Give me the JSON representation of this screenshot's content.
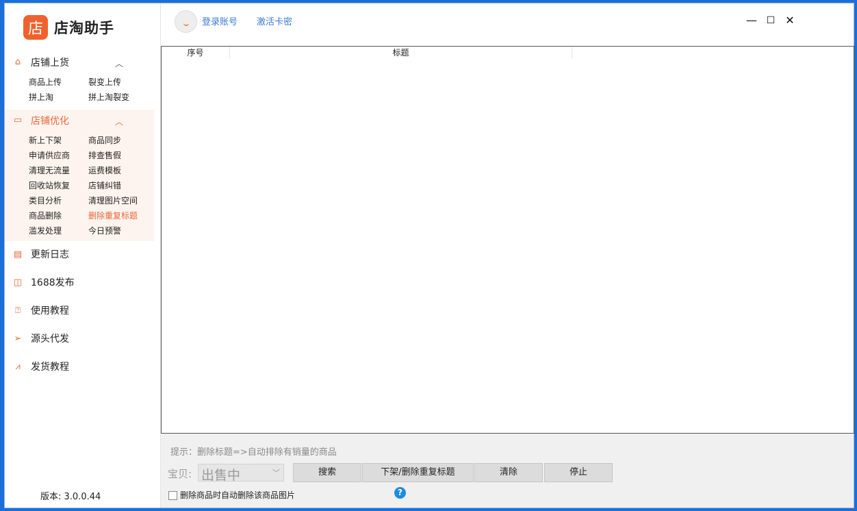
{
  "app": {
    "name": "店淘助手",
    "logo_char": "店",
    "version_label": "版本: 3.0.0.44"
  },
  "header": {
    "login": "登录账号",
    "activate": "激活卡密"
  },
  "window_controls": {
    "minimize": "—",
    "maximize": "☐",
    "close": "✕"
  },
  "sidebar": {
    "upload": {
      "title": "店铺上货",
      "items": [
        "商品上传",
        "裂变上传",
        "拼上淘",
        "拼上淘裂变"
      ]
    },
    "optimize": {
      "title": "店铺优化",
      "items": [
        "新上下架",
        "商品同步",
        "申请供应商",
        "排查售假",
        "清理无流量",
        "运费模板",
        "回收站恢复",
        "店铺纠错",
        "类目分析",
        "清理图片空间",
        "商品删除",
        "删除重复标题",
        "滥发处理",
        "今日预警"
      ],
      "active": "删除重复标题"
    },
    "nav": [
      "更新日志",
      "1688发布",
      "使用教程",
      "源头代发",
      "发货教程"
    ]
  },
  "table": {
    "columns": [
      "序号",
      "标题"
    ]
  },
  "bottom": {
    "tip": "提示：删除标题=>自动排除有销量的商品",
    "item_label": "宝贝:",
    "status_select": "出售中",
    "buttons": [
      "搜索",
      "下架/删除重复标题",
      "清除",
      "停止"
    ],
    "checkbox_label": "删除商品时自动删除该商品图片",
    "help": "?"
  },
  "colors": {
    "accent": "#f0622d",
    "link": "#3a7bd5",
    "active_bg": "#fef4ef",
    "help": "#1e8be0"
  }
}
